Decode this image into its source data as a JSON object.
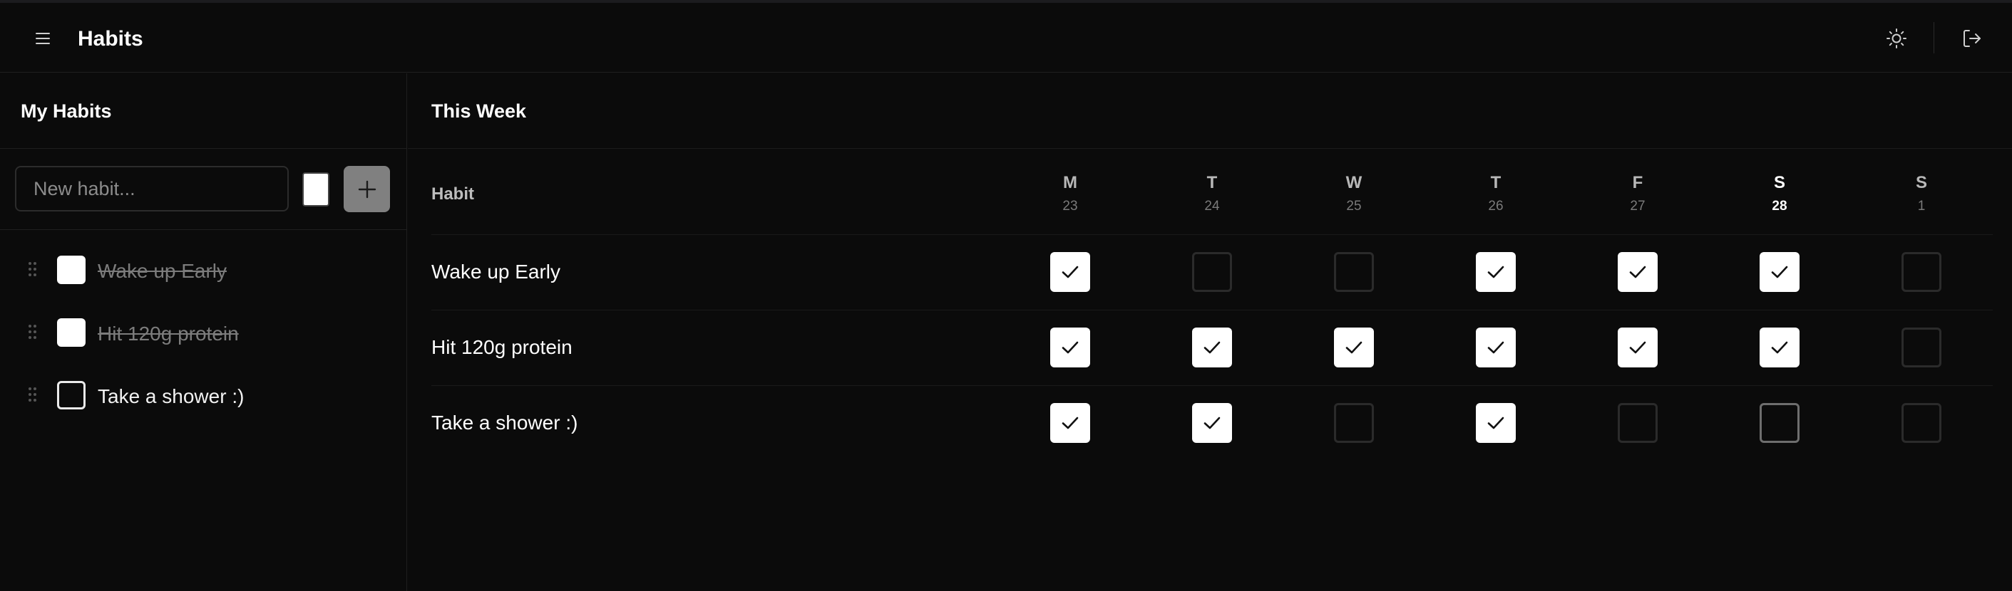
{
  "header": {
    "title": "Habits",
    "menu_icon": "hamburger-menu-icon",
    "theme_icon": "sun-icon",
    "logout_icon": "logout-icon"
  },
  "sidebar": {
    "title": "My Habits",
    "new_habit_placeholder": "New habit...",
    "new_habit_value": "",
    "swatch_color": "#ffffff",
    "add_icon": "plus-icon",
    "items": [
      {
        "label": "Wake up Early",
        "done": true
      },
      {
        "label": "Hit 120g protein",
        "done": true
      },
      {
        "label": "Take a shower :)",
        "done": false
      }
    ]
  },
  "week": {
    "title": "This Week",
    "habit_header": "Habit",
    "days": [
      {
        "letter": "M",
        "date": "23",
        "today": false
      },
      {
        "letter": "T",
        "date": "24",
        "today": false
      },
      {
        "letter": "W",
        "date": "25",
        "today": false
      },
      {
        "letter": "T",
        "date": "26",
        "today": false
      },
      {
        "letter": "F",
        "date": "27",
        "today": false
      },
      {
        "letter": "S",
        "date": "28",
        "today": true
      },
      {
        "letter": "S",
        "date": "1",
        "today": false
      }
    ],
    "rows": [
      {
        "habit": "Wake up Early",
        "checks": [
          true,
          false,
          false,
          true,
          true,
          true,
          false
        ]
      },
      {
        "habit": "Hit 120g protein",
        "checks": [
          true,
          true,
          true,
          true,
          true,
          true,
          false
        ]
      },
      {
        "habit": "Take a shower :)",
        "checks": [
          true,
          true,
          false,
          true,
          false,
          false,
          false
        ]
      }
    ]
  },
  "colors": {
    "background": "#0b0b0b",
    "checked": "#ffffff",
    "add_button": "#808080",
    "divider": "#1f1f1f"
  }
}
